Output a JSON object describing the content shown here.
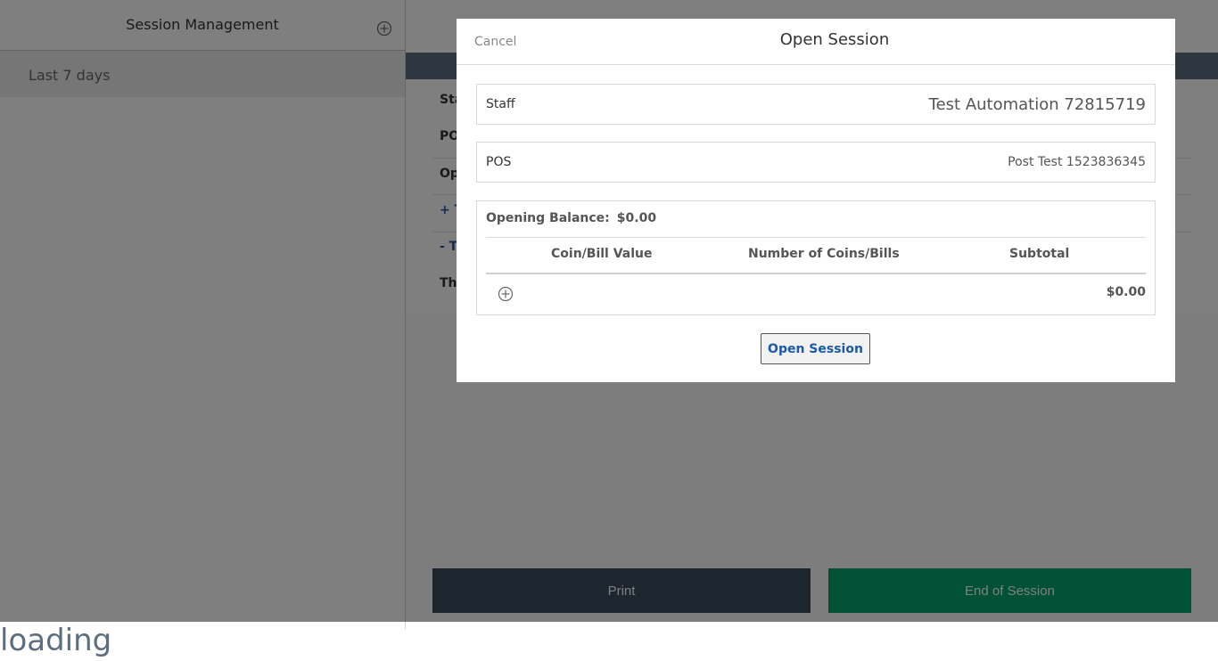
{
  "left": {
    "title": "Session Management",
    "filter": "Last 7 days"
  },
  "right": {
    "rows": [
      "Sta",
      "PO",
      "Op",
      "+ T",
      "- Tr",
      "The"
    ],
    "print_label": "Print",
    "end_label": "End of Session"
  },
  "modal": {
    "cancel": "Cancel",
    "title": "Open Session",
    "staff_label": "Staff",
    "staff_value": "Test Automation 72815719",
    "pos_label": "POS",
    "pos_value": "Post Test 1523836345",
    "balance_label": "Opening Balance:",
    "balance_value": "$0.00",
    "columns": [
      "Coin/Bill Value",
      "Number of Coins/Bills",
      "Subtotal"
    ],
    "row_subtotal": "$0.00",
    "open_button": "Open Session"
  },
  "loading": "loading",
  "colors": {
    "topbar": "#5c6e80",
    "print": "#3a4a5c",
    "end": "#00a36c",
    "link": "#1a5aa8"
  },
  "icons": [
    "add-circle-icon"
  ]
}
